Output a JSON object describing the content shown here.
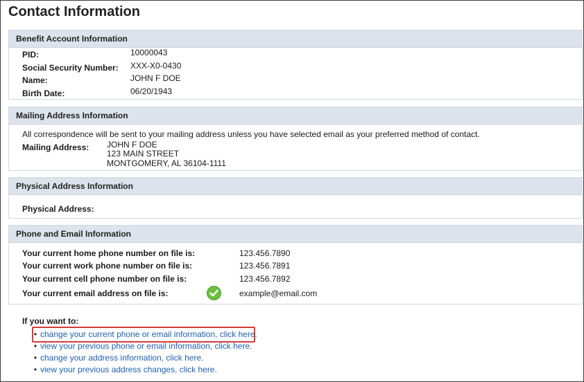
{
  "page_title": "Contact Information",
  "benefit": {
    "title": "Benefit Account Information",
    "pid_label": "PID:",
    "pid_value": "10000043",
    "ssn_label": "Social Security Number:",
    "ssn_value": "XXX-X0-0430",
    "name_label": "Name:",
    "name_value": "JOHN F DOE",
    "birth_label": "Birth Date:",
    "birth_value": "06/20/1943"
  },
  "mailing": {
    "title": "Mailing Address Information",
    "note": "All correspondence will be sent to your mailing address unless you have selected email as your preferred method of contact.",
    "label": "Mailing Address:",
    "line1": "JOHN F DOE",
    "line2": "123 MAIN STREET",
    "line3": "MONTGOMERY, AL 36104-1111"
  },
  "physical": {
    "title": "Physical Address Information",
    "label": "Physical Address:"
  },
  "phone": {
    "title": "Phone and Email Information",
    "home_label": "Your current home phone number on file is:",
    "home_value": "123.456.7890",
    "work_label": "Your current work phone number on file is:",
    "work_value": "123.456.7891",
    "cell_label": "Your current cell phone number on file is:",
    "cell_value": "123.456.7892",
    "email_label": "Your current email address on file is:",
    "email_value": "example@email.com",
    "email_verified_icon": "check-circle-icon",
    "check_color": "#6abf3c"
  },
  "actions": {
    "heading": "If you want to:",
    "links": [
      "change your current phone or email information, click here.",
      "view your previous phone or email information, click here.",
      "change your address information, click here.",
      "view your previous address changes, click here."
    ],
    "highlight_color": "#d83a3a",
    "link_color": "#1f5fae"
  }
}
